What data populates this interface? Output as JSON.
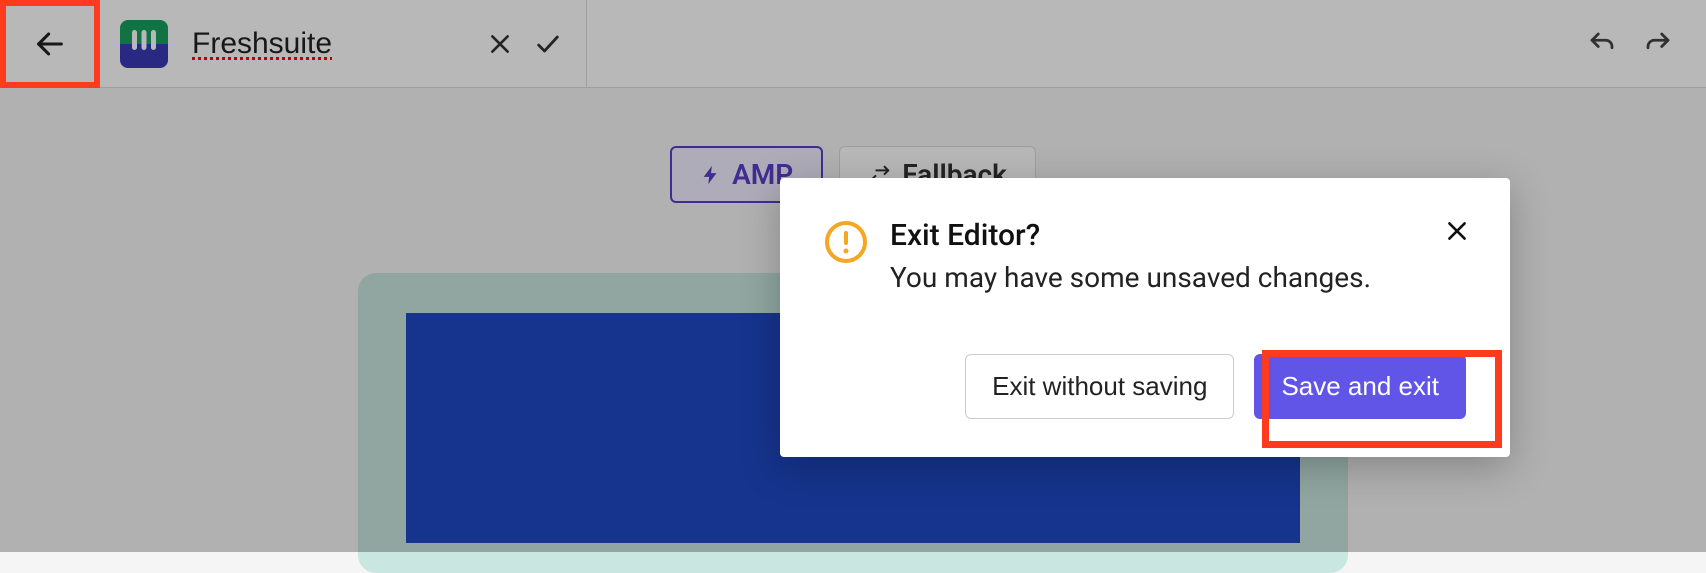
{
  "header": {
    "title_value": "Freshsuite"
  },
  "tabs": {
    "amp": "AMP",
    "fallback": "Fallback"
  },
  "modal": {
    "title": "Exit Editor?",
    "subtitle": "You may have some unsaved changes.",
    "secondary": "Exit without saving",
    "primary": "Save and exit"
  }
}
